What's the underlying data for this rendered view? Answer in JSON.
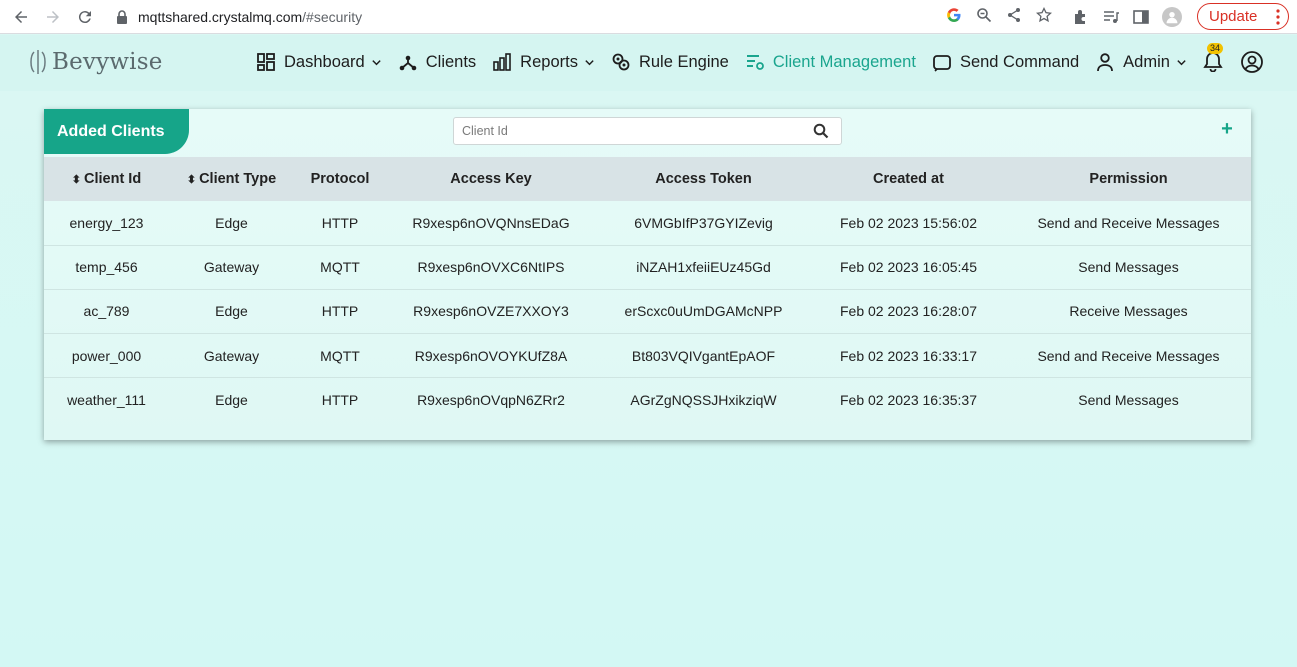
{
  "browser": {
    "url_host": "mqttshared.crystalmq.com",
    "url_path": "/#security",
    "update_label": "Update"
  },
  "app": {
    "logo_text": "Bevywise",
    "menu": [
      {
        "label": "Dashboard",
        "icon": "dashboard-icon",
        "dropdown": true
      },
      {
        "label": "Clients",
        "icon": "clients-icon",
        "dropdown": false
      },
      {
        "label": "Reports",
        "icon": "reports-icon",
        "dropdown": true
      },
      {
        "label": "Rule Engine",
        "icon": "rule-engine-icon",
        "dropdown": false
      },
      {
        "label": "Client Management",
        "icon": "client-management-icon",
        "dropdown": false,
        "active": true
      },
      {
        "label": "Send Command",
        "icon": "send-command-icon",
        "dropdown": false
      },
      {
        "label": "Admin",
        "icon": "admin-icon",
        "dropdown": true
      }
    ],
    "notification_count": "34",
    "accent_color": "#16a589"
  },
  "card": {
    "title": "Added Clients",
    "search_placeholder": "Client Id",
    "add_label": "+",
    "columns": [
      "Client Id",
      "Client Type",
      "Protocol",
      "Access Key",
      "Access Token",
      "Created at",
      "Permission"
    ],
    "rows": [
      [
        "energy_123",
        "Edge",
        "HTTP",
        "R9xesp6nOVQNnsEDaG",
        "6VMGbIfP37GYIZevig",
        "Feb 02 2023 15:56:02",
        "Send and Receive Messages"
      ],
      [
        "temp_456",
        "Gateway",
        "MQTT",
        "R9xesp6nOVXC6NtIPS",
        "iNZAH1xfeiiEUz45Gd",
        "Feb 02 2023 16:05:45",
        "Send Messages"
      ],
      [
        "ac_789",
        "Edge",
        "HTTP",
        "R9xesp6nOVZE7XXOY3",
        "erScxc0uUmDGAMcNPP",
        "Feb 02 2023 16:28:07",
        "Receive Messages"
      ],
      [
        "power_000",
        "Gateway",
        "MQTT",
        "R9xesp6nOVOYKUfZ8A",
        "Bt803VQIVgantEpAOF",
        "Feb 02 2023 16:33:17",
        "Send and Receive Messages"
      ],
      [
        "weather_111",
        "Edge",
        "HTTP",
        "R9xesp6nOVqpN6ZRr2",
        "AGrZgNQSSJHxikziqW",
        "Feb 02 2023 16:35:37",
        "Send Messages"
      ]
    ]
  }
}
